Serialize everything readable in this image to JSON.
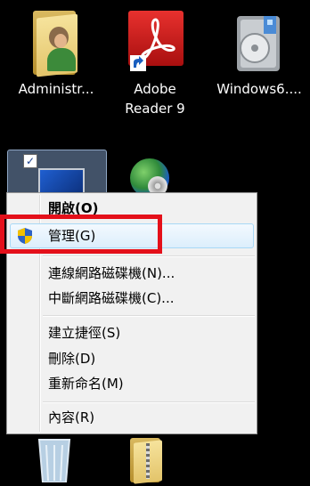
{
  "desktop": {
    "icons": [
      {
        "label": "Administr...",
        "icon": "user-folder-icon"
      },
      {
        "label": "Adobe Reader 9",
        "label_line1": "Adobe",
        "label_line2": "Reader 9",
        "icon": "adobe-reader-icon"
      },
      {
        "label": "Windows6....",
        "icon": "installer-package-icon"
      },
      {
        "label": "",
        "icon": "computer-icon"
      },
      {
        "label": "",
        "icon": "network-globe-icon"
      },
      {
        "label": "",
        "icon": "recycle-bin-icon"
      },
      {
        "label": "",
        "icon": "zip-folder-icon"
      }
    ]
  },
  "context_menu": {
    "items": [
      {
        "label": "開啟(O)",
        "bold": true
      },
      {
        "label": "管理(G)",
        "icon": "uac-shield-icon",
        "highlighted": true
      },
      {
        "label": "連線網路磁碟機(N)..."
      },
      {
        "label": "中斷網路磁碟機(C)..."
      },
      {
        "label": "建立捷徑(S)"
      },
      {
        "label": "刪除(D)"
      },
      {
        "label": "重新命名(M)"
      },
      {
        "label": "內容(R)"
      }
    ]
  },
  "colors": {
    "desktop_background": "#000000",
    "annotation_box": "#e4101a",
    "menu_background": "#f1f1f1",
    "highlight_border": "#a8d8f6"
  }
}
